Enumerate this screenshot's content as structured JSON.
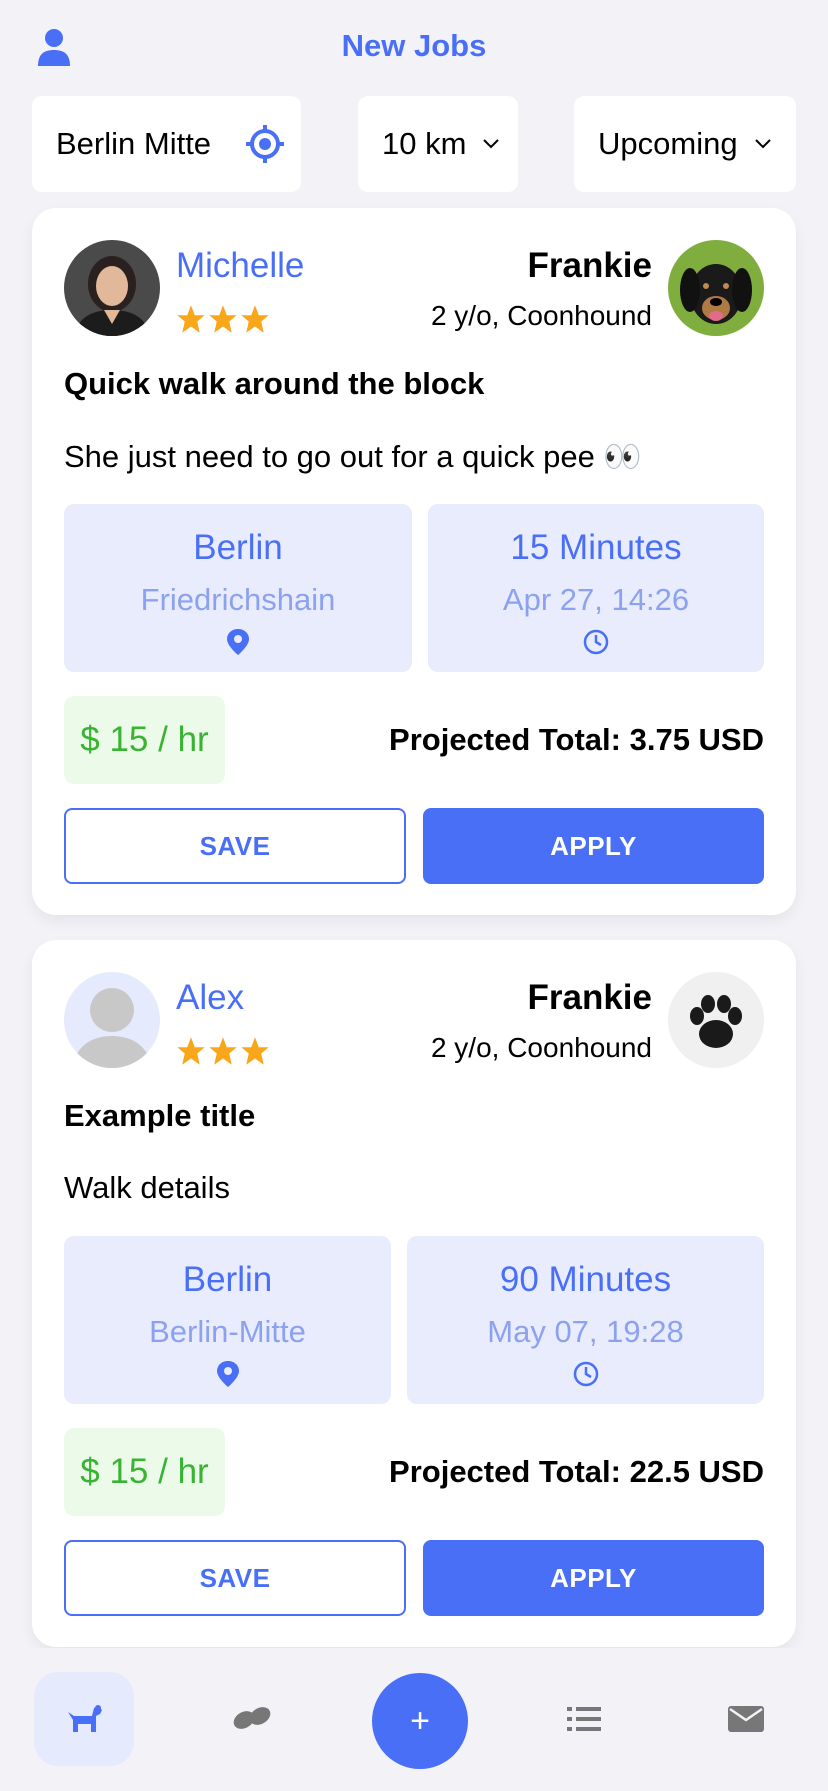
{
  "header": {
    "title": "New Jobs",
    "user_icon": "user-icon"
  },
  "filters": {
    "location": "Berlin Mitte",
    "distance": "10 km",
    "timeframe": "Upcoming"
  },
  "colors": {
    "accent": "#4a6ff7",
    "star": "#f9a71a",
    "rate_green": "#3ab334",
    "info_bg": "#e8ecfd"
  },
  "jobs": [
    {
      "owner_name": "Michelle",
      "owner_rating": 3,
      "pet_name": "Frankie",
      "pet_info": "2 y/o, Coonhound",
      "title": "Quick walk around the block",
      "details": "She just need to go out for a quick pee 👀",
      "location_city": "Berlin",
      "location_area": "Friedrichshain",
      "duration": "15 Minutes",
      "datetime": "Apr 27, 14:26",
      "rate": "$ 15 / hr",
      "projected_total": "Projected Total: 3.75 USD",
      "save_label": "SAVE",
      "apply_label": "APPLY"
    },
    {
      "owner_name": "Alex",
      "owner_rating": 3,
      "pet_name": "Frankie",
      "pet_info": "2 y/o, Coonhound",
      "title": "Example title",
      "details": "Walk details",
      "location_city": "Berlin",
      "location_area": "Berlin-Mitte",
      "duration": "90 Minutes",
      "datetime": "May 07, 19:28",
      "rate": "$ 15 / hr",
      "projected_total": "Projected Total: 22.5 USD",
      "save_label": "SAVE",
      "apply_label": "APPLY"
    }
  ],
  "bottom_nav": {
    "items": [
      "dog-icon",
      "footprints-icon",
      "plus-icon",
      "list-icon",
      "mail-icon"
    ],
    "plus_label": "+"
  }
}
